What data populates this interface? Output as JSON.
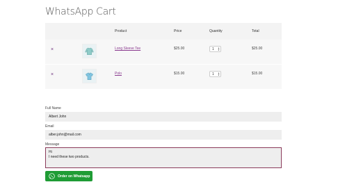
{
  "page": {
    "title": "WhatsApp Cart"
  },
  "cart": {
    "headers": {
      "product": "Product",
      "price": "Price",
      "quantity": "Quantity",
      "total": "Total"
    },
    "remove_symbol": "×",
    "items": [
      {
        "name": "Long Sleeve Tee",
        "price": "$25.00",
        "quantity": "1",
        "total": "$25.00",
        "icon": "long-sleeve-tee-thumbnail"
      },
      {
        "name": "Polo",
        "price": "$15.00",
        "quantity": "1",
        "total": "$15.00",
        "icon": "polo-shirt-thumbnail"
      }
    ]
  },
  "form": {
    "full_name_label": "Full Name",
    "full_name_value": "Albert John",
    "email_label": "Email",
    "email_value": "alber.john@mail.com",
    "message_label": "Message",
    "message_value": "Hi\nI need these two products."
  },
  "button": {
    "label": "Order on Whatsapp",
    "color": "#1f9c35"
  }
}
